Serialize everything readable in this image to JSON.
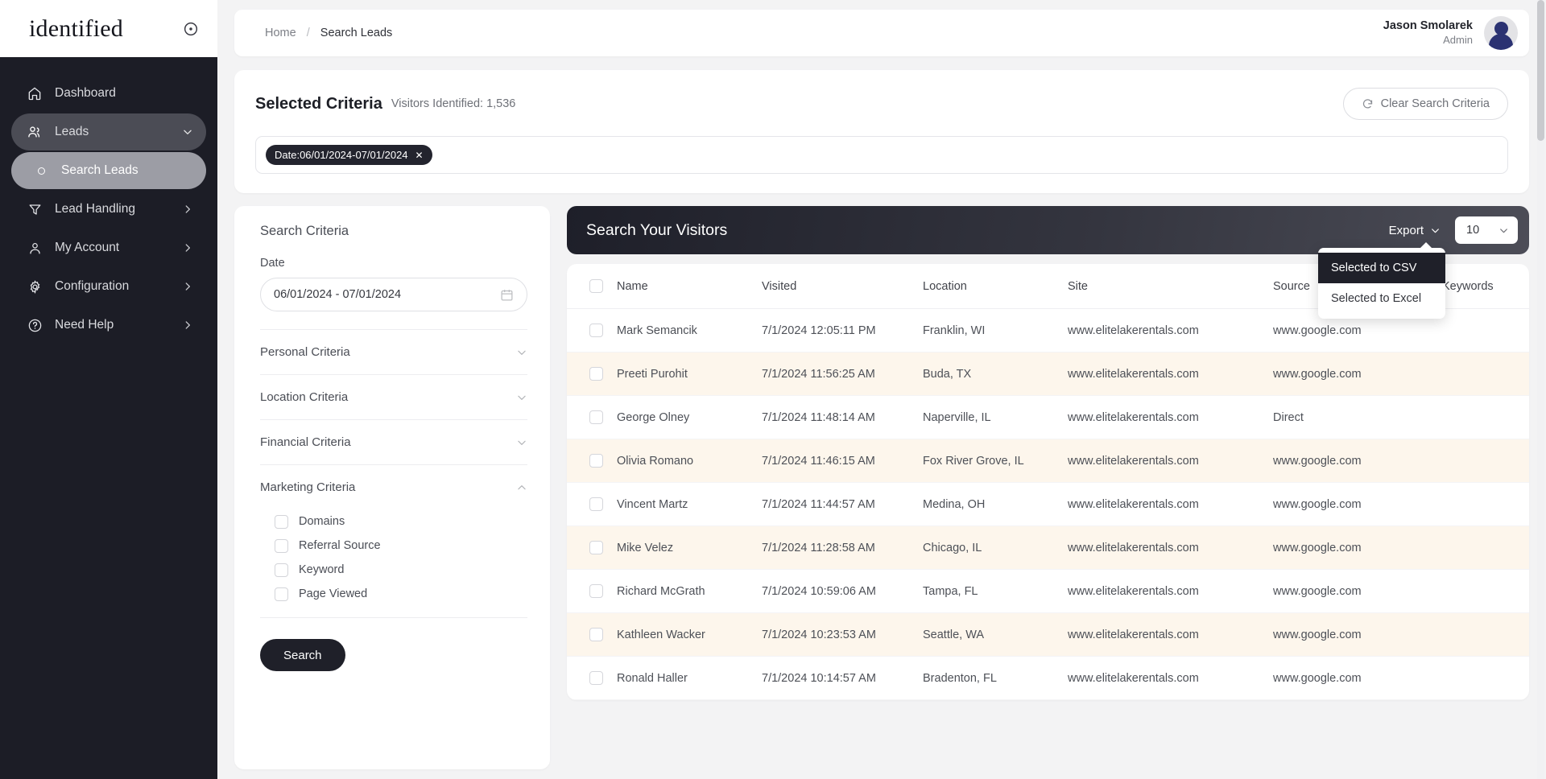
{
  "brand": {
    "name": "identified",
    "collapse_icon": "circle-dot-icon"
  },
  "sidebar": {
    "items": [
      {
        "label": "Dashboard",
        "icon": "home-icon",
        "state": "normal",
        "chevron": "none"
      },
      {
        "label": "Leads",
        "icon": "users-icon",
        "state": "active-parent",
        "chevron": "chevron-down-icon"
      },
      {
        "label": "Search Leads",
        "icon": "dot-icon",
        "state": "active-child",
        "chevron": "none"
      },
      {
        "label": "Lead Handling",
        "icon": "funnel-icon",
        "state": "normal",
        "chevron": "chevron-right-icon"
      },
      {
        "label": "My Account",
        "icon": "user-icon",
        "state": "normal",
        "chevron": "chevron-right-icon"
      },
      {
        "label": "Configuration",
        "icon": "gear-icon",
        "state": "normal",
        "chevron": "chevron-right-icon"
      },
      {
        "label": "Need Help",
        "icon": "help-circle-icon",
        "state": "normal",
        "chevron": "chevron-right-icon"
      }
    ]
  },
  "topbar": {
    "breadcrumb_home": "Home",
    "breadcrumb_sep": "/",
    "breadcrumb_current": "Search Leads",
    "user_name": "Jason Smolarek",
    "user_role": "Admin"
  },
  "selected_criteria": {
    "title": "Selected Criteria",
    "subtitle": "Visitors Identified: 1,536",
    "clear_button": "Clear Search Criteria",
    "clear_icon": "reset-icon",
    "chips": [
      {
        "label": "Date:06/01/2024-07/01/2024",
        "close": "✕"
      }
    ]
  },
  "search_criteria": {
    "title": "Search Criteria",
    "date_label": "Date",
    "date_value": "06/01/2024 - 07/01/2024",
    "date_icon": "calendar-icon",
    "sections": [
      {
        "label": "Personal Criteria",
        "expanded": false
      },
      {
        "label": "Location Criteria",
        "expanded": false
      },
      {
        "label": "Financial Criteria",
        "expanded": false
      },
      {
        "label": "Marketing Criteria",
        "expanded": true
      }
    ],
    "marketing_options": [
      {
        "label": "Domains",
        "checked": false
      },
      {
        "label": "Referral Source",
        "checked": false
      },
      {
        "label": "Keyword",
        "checked": false
      },
      {
        "label": "Page Viewed",
        "checked": false
      }
    ],
    "search_button": "Search"
  },
  "visitors": {
    "header_title": "Search Your Visitors",
    "export_label": "Export",
    "page_size_value": "10",
    "export_menu": [
      {
        "label": "Selected to CSV",
        "selected": true
      },
      {
        "label": "Selected to Excel",
        "selected": false
      }
    ],
    "columns": [
      "",
      "Name",
      "Visited",
      "Location",
      "Site",
      "Source",
      "Keywords"
    ],
    "rows": [
      {
        "name": "Mark Semancik",
        "visited": "7/1/2024 12:05:11 PM",
        "location": "Franklin, WI",
        "site": "www.elitelakerentals.com",
        "source": "www.google.com",
        "keywords": ""
      },
      {
        "name": "Preeti Purohit",
        "visited": "7/1/2024 11:56:25 AM",
        "location": "Buda, TX",
        "site": "www.elitelakerentals.com",
        "source": "www.google.com",
        "keywords": ""
      },
      {
        "name": "George Olney",
        "visited": "7/1/2024 11:48:14 AM",
        "location": "Naperville, IL",
        "site": "www.elitelakerentals.com",
        "source": "Direct",
        "keywords": ""
      },
      {
        "name": "Olivia Romano",
        "visited": "7/1/2024 11:46:15 AM",
        "location": "Fox River Grove, IL",
        "site": "www.elitelakerentals.com",
        "source": "www.google.com",
        "keywords": ""
      },
      {
        "name": "Vincent Martz",
        "visited": "7/1/2024 11:44:57 AM",
        "location": "Medina, OH",
        "site": "www.elitelakerentals.com",
        "source": "www.google.com",
        "keywords": ""
      },
      {
        "name": "Mike Velez",
        "visited": "7/1/2024 11:28:58 AM",
        "location": "Chicago, IL",
        "site": "www.elitelakerentals.com",
        "source": "www.google.com",
        "keywords": ""
      },
      {
        "name": "Richard McGrath",
        "visited": "7/1/2024 10:59:06 AM",
        "location": "Tampa, FL",
        "site": "www.elitelakerentals.com",
        "source": "www.google.com",
        "keywords": ""
      },
      {
        "name": "Kathleen Wacker",
        "visited": "7/1/2024 10:23:53 AM",
        "location": "Seattle, WA",
        "site": "www.elitelakerentals.com",
        "source": "www.google.com",
        "keywords": ""
      },
      {
        "name": "Ronald Haller",
        "visited": "7/1/2024 10:14:57 AM",
        "location": "Bradenton, FL",
        "site": "www.elitelakerentals.com",
        "source": "www.google.com",
        "keywords": ""
      }
    ]
  },
  "colors": {
    "sidebar_bg": "#1c1d26",
    "accent_dark": "#1f2029",
    "row_alt": "#fdf6ec",
    "avatar": "#2b3272"
  }
}
